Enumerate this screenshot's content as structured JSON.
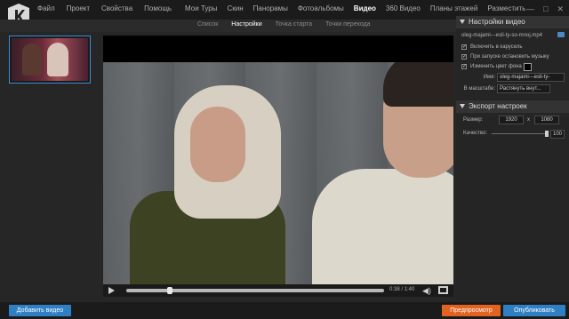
{
  "menu": {
    "left": [
      "Файл",
      "Проект",
      "Свойства",
      "Помощь"
    ],
    "right": [
      "Мои Туры",
      "Скин",
      "Панорамы",
      "Фотоальбомы",
      "Видео",
      "360 Видео",
      "Планы этажей",
      "Разместить"
    ],
    "active": "Видео"
  },
  "subtabs": {
    "items": [
      "Список",
      "Настройки",
      "Точка старта",
      "Точки перехода"
    ],
    "active": "Настройки"
  },
  "player": {
    "time": "0:38 / 1:40",
    "progress": 0.17
  },
  "settings": {
    "header": "Настройки видео",
    "file": "oleg-majami---esli-ty-so-mnoj.mp4",
    "opt_loop": "Включить в карусель",
    "opt_mute": "При запуске остановить музыку",
    "opt_bg": "Изменить цвет фона",
    "name_label": "Имя:",
    "name_value": "oleg-majami---esli-ty-",
    "scale_label": "В масштабе:",
    "scale_value": "Растянуть внут..."
  },
  "export": {
    "header": "Экспорт настроек",
    "size_label": "Размер:",
    "width": "1920",
    "x": "x",
    "height": "1080",
    "quality_label": "Качество:",
    "quality": "100"
  },
  "buttons": {
    "add": "Добавить видео",
    "preview": "Предпросмотр",
    "publish": "Опубликовать"
  },
  "colors": {
    "accent": "#2f7fc4",
    "preview": "#e2621f",
    "bg": "#262626"
  }
}
